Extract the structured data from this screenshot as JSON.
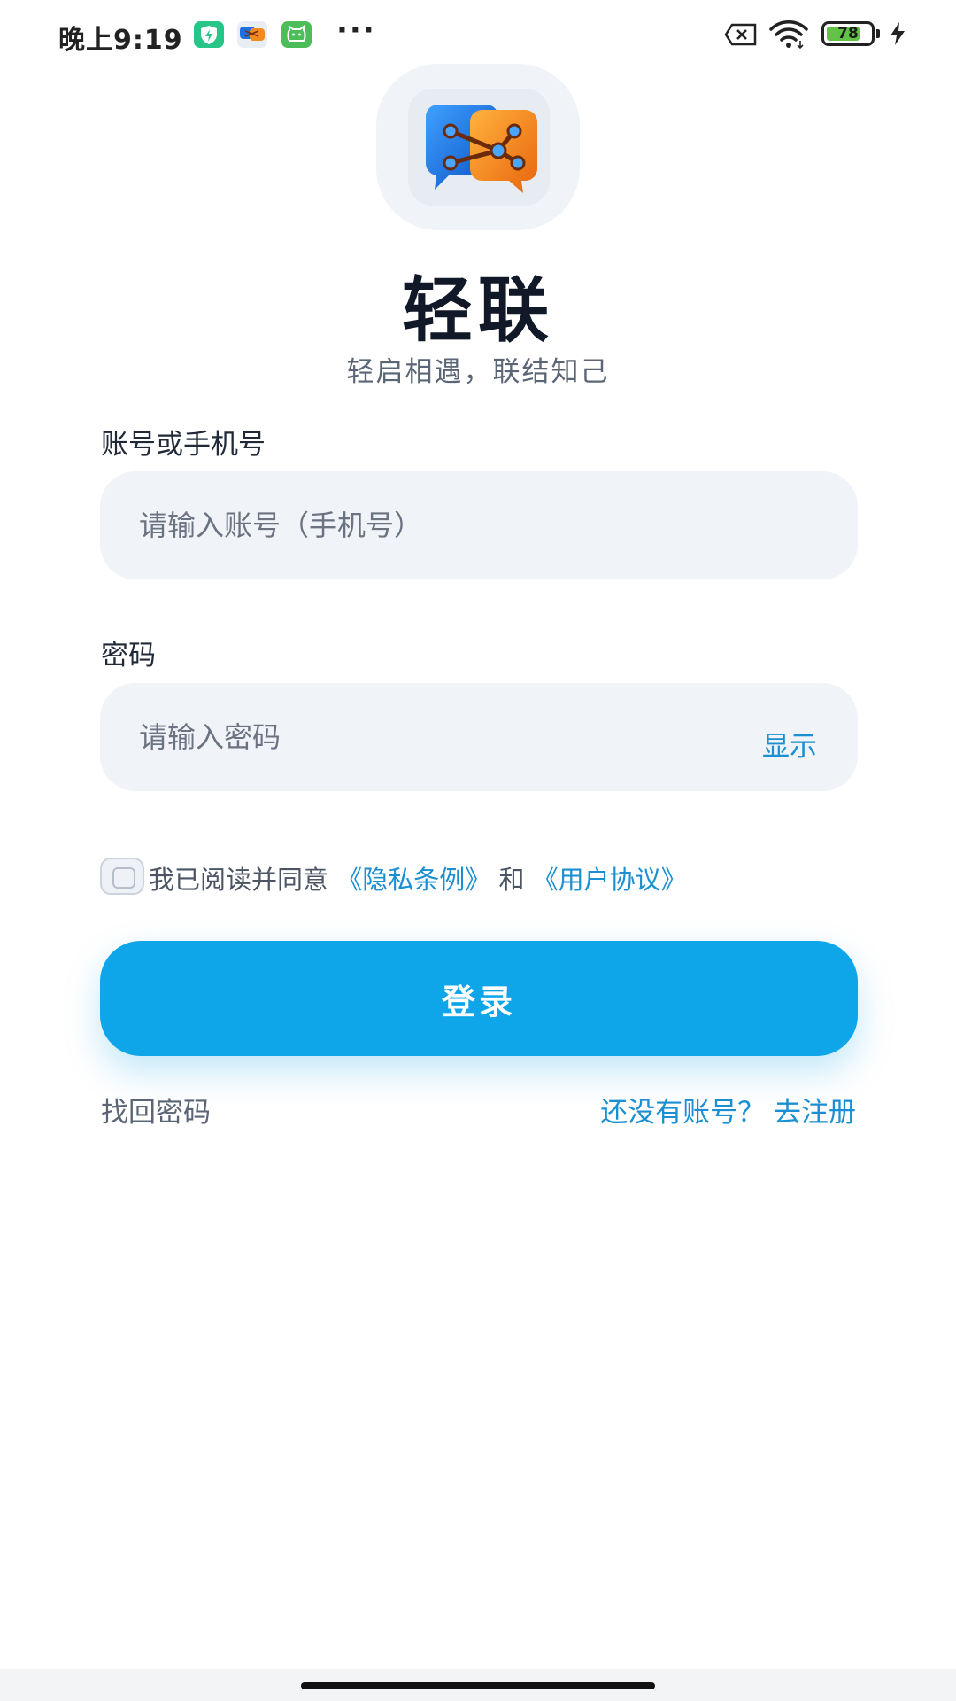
{
  "status_bar": {
    "time": "晚上9:19",
    "notification_icons": [
      "shield-bolt-icon",
      "chat-app-icon",
      "cat-app-icon"
    ],
    "more": "···",
    "battery_level": "78",
    "battery_fraction": 0.78,
    "charging": true,
    "indicators": [
      "no-sim-icon",
      "wifi-icon",
      "battery-icon",
      "charging-bolt-icon"
    ]
  },
  "app": {
    "name": "轻联",
    "slogan": "轻启相遇，联结知己"
  },
  "account_field": {
    "label": "账号或手机号",
    "placeholder": "请输入账号（手机号）",
    "value": ""
  },
  "password_field": {
    "label": "密码",
    "placeholder": "请输入密码",
    "value": "",
    "toggle_label": "显示"
  },
  "agreement": {
    "checked": false,
    "prefix": "我已阅读并同意 ",
    "privacy_link": "《隐私条例》",
    "conjunction": " 和 ",
    "terms_link": "《用户协议》"
  },
  "actions": {
    "login_label": "登录",
    "forgot_password": "找回密码",
    "register": "还没有账号？ 去注册"
  },
  "colors": {
    "accent": "#0ea5e9",
    "link": "#1a8fd1",
    "field_bg": "#f0f3f8",
    "title": "#111827"
  }
}
